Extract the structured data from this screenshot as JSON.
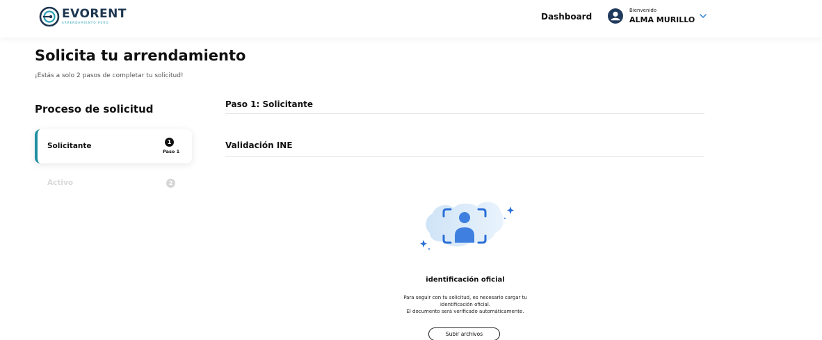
{
  "brand": {
    "name": "EVORENT",
    "tagline": "ARRENDAMIENTO PURO",
    "color": "#1d3650",
    "accent": "#2ba0b4"
  },
  "header": {
    "nav_dashboard": "Dashboard",
    "user_greeting": "Bienvenido",
    "user_name": "ALMA MURILLO",
    "user_icon": "user-icon",
    "menu_icon": "chevron-down-icon"
  },
  "page": {
    "title": "Solicita tu arrendamiento",
    "subtitle": "¡Estás a solo 2 pasos de completar tu solicitud!"
  },
  "sidebar": {
    "title": "Proceso de solicitud",
    "steps": [
      {
        "label": "Solicitante",
        "number": "1",
        "sublabel": "Paso 1",
        "active": true
      },
      {
        "label": "Activo",
        "number": "2",
        "active": false
      }
    ],
    "active_color": "#1f8ea3"
  },
  "main": {
    "step_heading": "Paso 1: Solicitante",
    "section_heading": "Validación INE",
    "illustration_icon": "face-id-scan-icon",
    "id_title": "identificación oficial",
    "id_desc_lines": [
      "Para seguir con tu solicitud, es necesario cargar tu",
      "identificación oficial.",
      "El documento será verificado automáticamente."
    ],
    "upload_button": "Subir archivos"
  }
}
